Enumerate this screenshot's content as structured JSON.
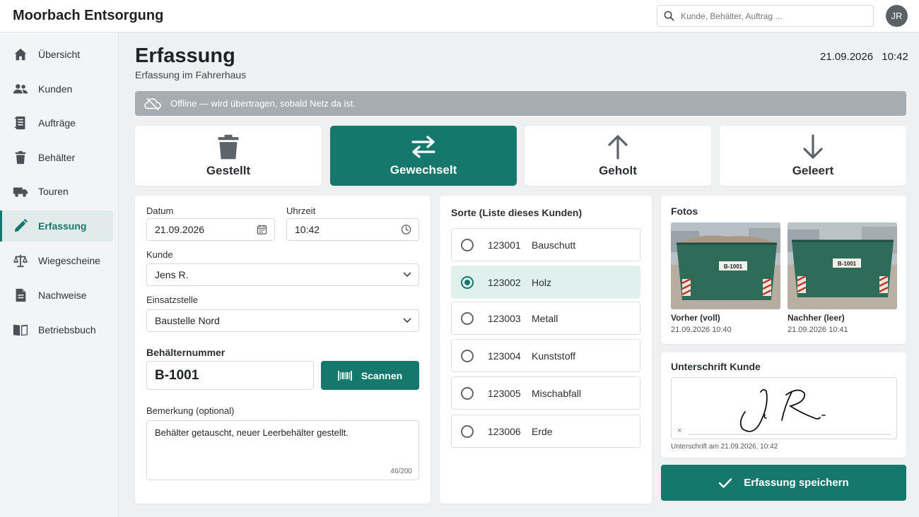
{
  "header": {
    "brand": "Moorbach Entsorgung",
    "search_placeholder": "Kunde, Behälter, Auftrag ...",
    "avatar_initials": "JR"
  },
  "sidebar": {
    "items": [
      {
        "label": "Übersicht",
        "icon": "home-icon"
      },
      {
        "label": "Kunden",
        "icon": "users-icon"
      },
      {
        "label": "Aufträge",
        "icon": "orders-icon"
      },
      {
        "label": "Behälter",
        "icon": "trash-icon"
      },
      {
        "label": "Touren",
        "icon": "truck-icon"
      },
      {
        "label": "Erfassung",
        "icon": "pencil-icon",
        "active": true
      },
      {
        "label": "Wiegescheine",
        "icon": "scale-icon"
      },
      {
        "label": "Nachweise",
        "icon": "document-icon"
      },
      {
        "label": "Betriebsbuch",
        "icon": "book-icon"
      }
    ]
  },
  "page": {
    "title": "Erfassung",
    "subtitle": "Erfassung im Fahrerhaus",
    "date": "21.09.2026",
    "time": "10:42"
  },
  "offline_banner": "Offline — wird übertragen, sobald Netz da ist.",
  "modes": [
    {
      "label": "Gestellt",
      "icon": "trash-icon",
      "active": false
    },
    {
      "label": "Gewechselt",
      "icon": "swap-icon",
      "active": true
    },
    {
      "label": "Geholt",
      "icon": "arrow-up-icon",
      "active": false
    },
    {
      "label": "Geleert",
      "icon": "arrow-down-icon",
      "active": false
    }
  ],
  "form": {
    "datum_label": "Datum",
    "datum_value": "21.09.2026",
    "uhrzeit_label": "Uhrzeit",
    "uhrzeit_value": "10:42",
    "kunde_label": "Kunde",
    "kunde_value": "Jens R.",
    "einsatz_label": "Einsatzstelle",
    "einsatz_value": "Baustelle Nord",
    "behaelter_label": "Behälternummer",
    "behaelter_value": "B-1001",
    "scan_label": "Scannen",
    "bemerkung_label": "Bemerkung (optional)",
    "bemerkung_value": "Behälter getauscht, neuer Leerbehälter gestellt.",
    "bemerkung_count": "46/200"
  },
  "sorte": {
    "title": "Sorte (Liste dieses Kunden)",
    "items": [
      {
        "code": "123001",
        "name": "Bauschutt",
        "selected": false
      },
      {
        "code": "123002",
        "name": "Holz",
        "selected": true
      },
      {
        "code": "123003",
        "name": "Metall",
        "selected": false
      },
      {
        "code": "123004",
        "name": "Kunststoff",
        "selected": false
      },
      {
        "code": "123005",
        "name": "Mischabfall",
        "selected": false
      },
      {
        "code": "123006",
        "name": "Erde",
        "selected": false
      }
    ]
  },
  "photos": {
    "title": "Fotos",
    "items": [
      {
        "caption": "Vorher (voll)",
        "date": "21.09.2026 10:40",
        "tag": "B-1001"
      },
      {
        "caption": "Nachher (leer)",
        "date": "21.09.2026 10:41",
        "tag": "B-1001"
      }
    ]
  },
  "signature": {
    "title": "Unterschrift Kunde",
    "clear_symbol": "×",
    "caption": "Unterschrift am 21.09.2026, 10:42"
  },
  "save_label": "Erfassung speichern",
  "colors": {
    "accent": "#16786d",
    "offline_banner": "#a6acb0",
    "selected_row": "#dff0ed"
  }
}
